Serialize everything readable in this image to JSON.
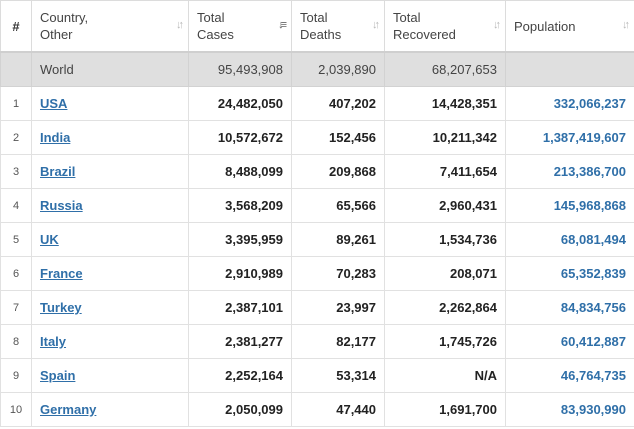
{
  "headers": {
    "index": "#",
    "country": [
      "Country,",
      "Other"
    ],
    "cases": [
      "Total",
      "Cases"
    ],
    "deaths": [
      "Total",
      "Deaths"
    ],
    "recovered": [
      "Total",
      "Recovered"
    ],
    "population": "Population"
  },
  "sort_icons": {
    "country": "sort-both-icon",
    "cases": "sort-desc-active-icon",
    "deaths": "sort-both-icon",
    "recovered": "sort-both-icon",
    "population": "sort-both-icon"
  },
  "world": {
    "country": "World",
    "cases": "95,493,908",
    "deaths": "2,039,890",
    "recovered": "68,207,653",
    "population": ""
  },
  "rows": [
    {
      "rank": "1",
      "country": "USA",
      "cases": "24,482,050",
      "deaths": "407,202",
      "recovered": "14,428,351",
      "population": "332,066,237"
    },
    {
      "rank": "2",
      "country": "India",
      "cases": "10,572,672",
      "deaths": "152,456",
      "recovered": "10,211,342",
      "population": "1,387,419,607"
    },
    {
      "rank": "3",
      "country": "Brazil",
      "cases": "8,488,099",
      "deaths": "209,868",
      "recovered": "7,411,654",
      "population": "213,386,700"
    },
    {
      "rank": "4",
      "country": "Russia",
      "cases": "3,568,209",
      "deaths": "65,566",
      "recovered": "2,960,431",
      "population": "145,968,868"
    },
    {
      "rank": "5",
      "country": "UK",
      "cases": "3,395,959",
      "deaths": "89,261",
      "recovered": "1,534,736",
      "population": "68,081,494"
    },
    {
      "rank": "6",
      "country": "France",
      "cases": "2,910,989",
      "deaths": "70,283",
      "recovered": "208,071",
      "population": "65,352,839"
    },
    {
      "rank": "7",
      "country": "Turkey",
      "cases": "2,387,101",
      "deaths": "23,997",
      "recovered": "2,262,864",
      "population": "84,834,756"
    },
    {
      "rank": "8",
      "country": "Italy",
      "cases": "2,381,277",
      "deaths": "82,177",
      "recovered": "1,745,726",
      "population": "60,412,887"
    },
    {
      "rank": "9",
      "country": "Spain",
      "cases": "2,252,164",
      "deaths": "53,314",
      "recovered": "N/A",
      "population": "46,764,735"
    },
    {
      "rank": "10",
      "country": "Germany",
      "cases": "2,050,099",
      "deaths": "47,440",
      "recovered": "1,691,700",
      "population": "83,930,990"
    }
  ],
  "colors": {
    "link": "#2f6fa8",
    "world_row_bg": "#dfdfdf",
    "border": "#e1e1e1"
  }
}
